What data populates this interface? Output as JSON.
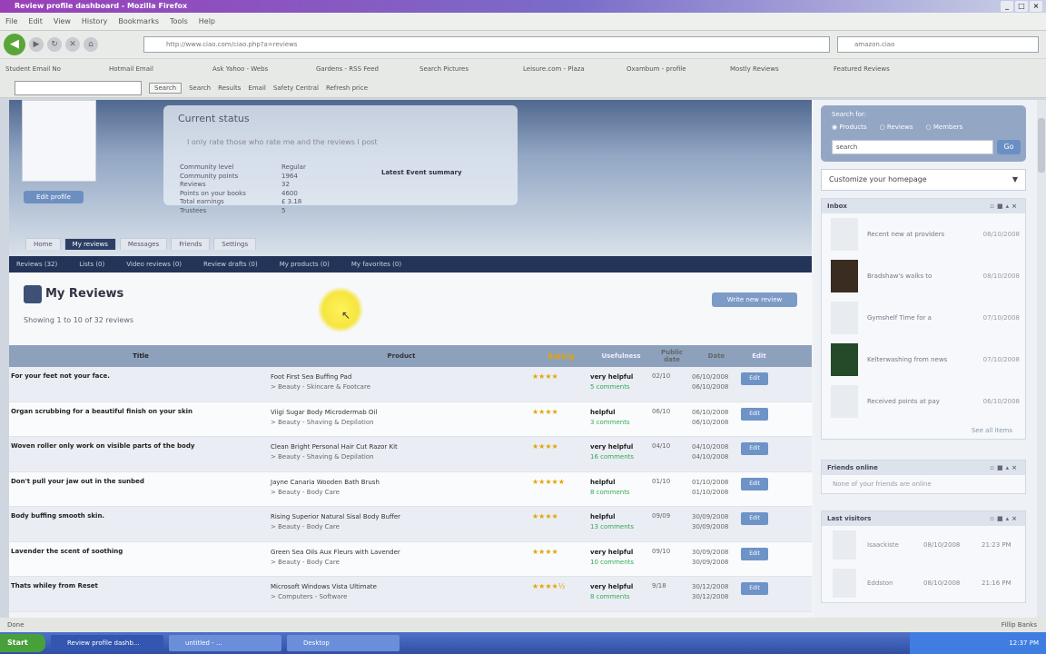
{
  "window": {
    "title": "Review profile dashboard - Mozilla Firefox"
  },
  "menu": [
    "File",
    "Edit",
    "View",
    "History",
    "Bookmarks",
    "Tools",
    "Help"
  ],
  "address": {
    "url": "http://www.ciao.com/ciao.php?a=reviews",
    "search": "amazon.ciao"
  },
  "bookmarks": [
    "Student Email No",
    "Hotmail Email",
    "Ask Yahoo - Webs",
    "Gardens - RSS Feed",
    "Search Pictures",
    "Leisure.com - Plaza",
    "Oxambum - profile",
    "Mostly Reviews",
    "Featured Reviews"
  ],
  "toolbar2": {
    "search_btn": "Search",
    "items": [
      "Search",
      "Results",
      "Email",
      "Safety Central",
      "Refresh price"
    ]
  },
  "profile": {
    "edit_label": "Edit profile"
  },
  "status": {
    "title": "Current status",
    "line": "I only rate those who rate me and the reviews I post",
    "stats": [
      {
        "k": "Community level",
        "v": "Regular"
      },
      {
        "k": "Community points",
        "v": "1964"
      },
      {
        "k": "Reviews",
        "v": "32"
      },
      {
        "k": "Points on your books",
        "v": "4600"
      },
      {
        "k": "Total earnings",
        "v": "£ 3.18"
      },
      {
        "k": "Trustees",
        "v": "5"
      }
    ],
    "prev_link": "Latest Event summary"
  },
  "tabs": [
    "Home",
    "My reviews",
    "Messages",
    "Friends",
    "Settings"
  ],
  "subnav": [
    "Reviews (32)",
    "Lists (0)",
    "Video reviews (0)",
    "Review drafts (0)",
    "My products (0)",
    "My favorites (0)"
  ],
  "section": {
    "title": "My Reviews",
    "showing": "Showing 1 to 10 of 32 reviews",
    "write_label": "Write new review"
  },
  "table": {
    "headers": [
      "Title",
      "Product",
      "Rating",
      "Usefulness",
      "Public date",
      "Date",
      "Edit"
    ],
    "rows": [
      {
        "title": "For your feet not your face.",
        "product": "Foot First Sea Buffing Pad",
        "category": "> Beauty - Skincare & Footcare",
        "rating": "★★★★",
        "help": "very helpful",
        "comments": "5 comments",
        "d1": "02/10",
        "d2": "06/10/2008",
        "d3": "06/10/2008",
        "edit": "Edit"
      },
      {
        "title": "Organ scrubbing for a beautiful finish on your skin",
        "product": "Viigi Sugar Body Microdermab Oil",
        "category": "> Beauty - Shaving & Depilation",
        "rating": "★★★★",
        "help": "helpful",
        "comments": "3 comments",
        "d1": "06/10",
        "d2": "06/10/2008",
        "d3": "06/10/2008",
        "edit": "Edit"
      },
      {
        "title": "Woven roller only work on visible parts of the body",
        "product": "Clean Bright Personal Hair Cut Razor Kit",
        "category": "> Beauty - Shaving & Depilation",
        "rating": "★★★★",
        "help": "very helpful",
        "comments": "16 comments",
        "d1": "04/10",
        "d2": "04/10/2008",
        "d3": "04/10/2008",
        "edit": "Edit"
      },
      {
        "title": "Don't pull your jaw out in the sunbed",
        "product": "Jayne Canaria Wooden Bath Brush",
        "category": "> Beauty - Body Care",
        "rating": "★★★★★",
        "help": "helpful",
        "comments": "8 comments",
        "d1": "01/10",
        "d2": "01/10/2008",
        "d3": "01/10/2008",
        "edit": "Edit"
      },
      {
        "title": "Body buffing smooth skin.",
        "product": "Rising Superior Natural Sisal Body Buffer",
        "category": "> Beauty - Body Care",
        "rating": "★★★★",
        "help": "helpful",
        "comments": "13 comments",
        "d1": "09/09",
        "d2": "30/09/2008",
        "d3": "30/09/2008",
        "edit": "Edit"
      },
      {
        "title": "Lavender the scent of soothing",
        "product": "Green Sea Oils Aux Fleurs with Lavender",
        "category": "> Beauty - Body Care",
        "rating": "★★★★",
        "help": "very helpful",
        "comments": "10 comments",
        "d1": "09/10",
        "d2": "30/09/2008",
        "d3": "30/09/2008",
        "edit": "Edit"
      },
      {
        "title": "Thats whiley from Reset",
        "product": "Microsoft Windows Vista Ultimate",
        "category": "> Computers - Software",
        "rating": "★★★★½",
        "help": "very helpful",
        "comments": "8 comments",
        "d1": "9/18",
        "d2": "30/12/2008",
        "d3": "30/12/2008",
        "edit": "Edit"
      }
    ]
  },
  "sidebar": {
    "search": {
      "label": "Search for:",
      "options": [
        "Products",
        "Reviews",
        "Members"
      ],
      "value": "search",
      "go": "Go"
    },
    "customize": "Customize your homepage",
    "inbox": {
      "title": "Inbox",
      "items": [
        {
          "name": "Recent new at providers",
          "date": "08/10/2008"
        },
        {
          "name": "Bradshaw's walks to",
          "date": "08/10/2008"
        },
        {
          "name": "Gymshelf Time for a",
          "date": "07/10/2008"
        },
        {
          "name": "Kelterwashing from news",
          "date": "07/10/2008"
        },
        {
          "name": "Received points at pay",
          "date": "06/10/2008"
        }
      ],
      "see_all": "See all items"
    },
    "online": {
      "title": "Friends online",
      "text": "None of your friends are online"
    },
    "visitors": {
      "title": "Last visitors",
      "items": [
        {
          "name": "Isaackiste",
          "date": "08/10/2008",
          "time": "21:23 PM"
        },
        {
          "name": "Eddston",
          "date": "08/10/2008",
          "time": "21:16 PM"
        }
      ]
    }
  },
  "statusbar": {
    "text": "Done",
    "right": "Fillip Banks"
  },
  "taskbar": {
    "start": "Start",
    "items": [
      "Review profile dashb...",
      "untitled - ...",
      "Desktop"
    ],
    "clock": "12:37 PM"
  }
}
